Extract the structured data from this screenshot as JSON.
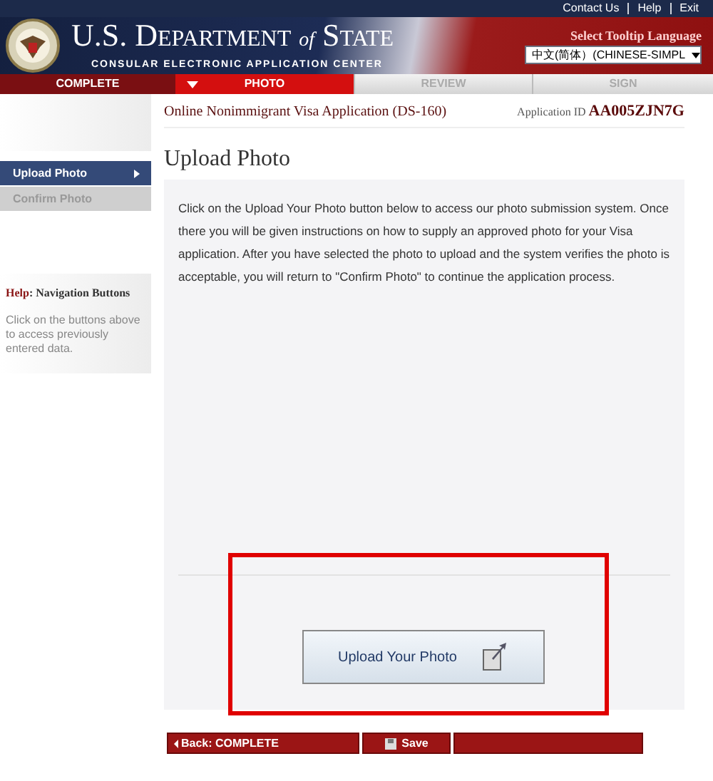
{
  "top_links": [
    "Contact Us",
    "Help",
    "Exit"
  ],
  "header": {
    "title_main": "U.S. D",
    "title_caps": "EPARTMENT",
    "title_of": "of",
    "title_s": "S",
    "title_tate": "TATE",
    "subtitle": "CONSULAR ELECTRONIC APPLICATION CENTER",
    "tooltip_label": "Select Tooltip Language",
    "language": "中文(简体）(CHINESE-SIMPL"
  },
  "steps": [
    {
      "label": "COMPLETE",
      "completed": true,
      "selected": false
    },
    {
      "label": "PHOTO",
      "completed": false,
      "selected": true
    },
    {
      "label": "REVIEW",
      "completed": false,
      "selected": false
    },
    {
      "label": "SIGN",
      "completed": false,
      "selected": false
    }
  ],
  "application": {
    "title": "Online Nonimmigrant Visa Application (DS-160)",
    "id_label": "Application ID",
    "id": "AA005ZJN7G"
  },
  "sidebar": {
    "items": [
      {
        "label": "Upload Photo",
        "selected": true
      },
      {
        "label": "Confirm Photo",
        "selected": false
      }
    ],
    "help_title": "Help",
    "help_topic": ": Navigation Buttons",
    "help_text": "Click on the buttons above to access previously entered data."
  },
  "page_title": "Upload Photo",
  "instructions": "Click on the Upload Your Photo button below to access our photo submission system. Once there you will be given instructions on how to supply an approved photo for your Visa application. After you have selected the photo to upload and the system verifies the photo is acceptable, you will return to \"Confirm Photo\" to continue the application process.",
  "upload_button": "Upload Your Photo",
  "nav": {
    "back": "Back: COMPLETE",
    "save": "Save"
  }
}
